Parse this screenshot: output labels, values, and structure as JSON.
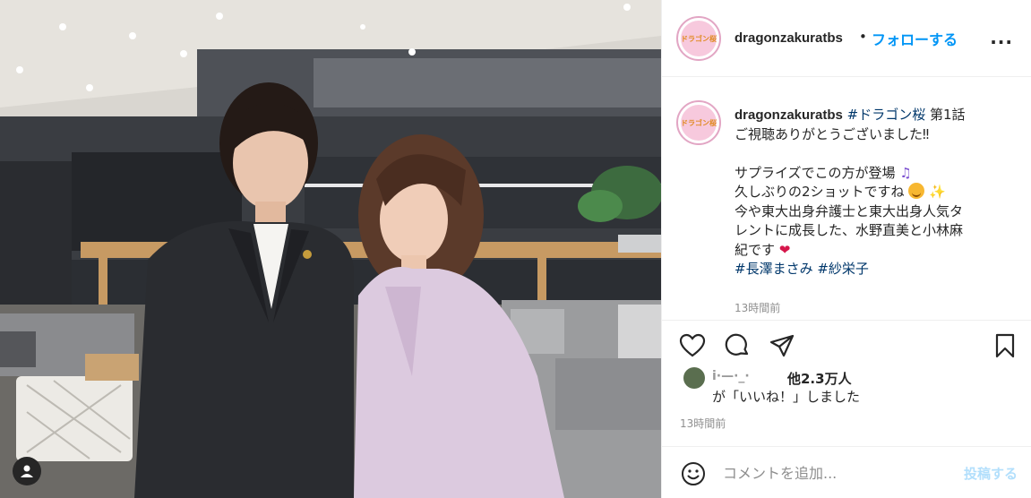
{
  "post": {
    "author": "dragonzakuratbs",
    "follow_separator": "•",
    "follow_label": "フォローする",
    "more_label": "...",
    "avatar_text": "ドラゴン桜",
    "caption": {
      "hashtag_title": "#ドラゴン桜",
      "episode": "第1話",
      "line2": "ご視聴ありがとうございました‼",
      "line3": "サプライズでこの方が登場",
      "line4": "久しぶりの2ショットですね",
      "line5": "今や東大出身弁護士と東大出身人気タ",
      "line6": "レントに成長した、水野直美と小林麻",
      "line7": "紀です",
      "tag1": "#長澤まさみ",
      "tag2": "#紗栄子",
      "time": "13時間前"
    },
    "likes": {
      "liker_name": "i·—·_·",
      "count": "他2.3万人",
      "suffix": "が「いいね！」しました"
    },
    "timestamp": "13時間前",
    "comment": {
      "placeholder": "コメントを追加...",
      "post_label": "投稿する"
    }
  },
  "icons": {
    "like": "heart-icon",
    "comment": "comment-icon",
    "share": "paper-plane-icon",
    "save": "bookmark-icon",
    "emoji": "smiley-icon",
    "more": "more-horizontal-icon",
    "user_tag": "person-icon"
  },
  "colors": {
    "follow": "#0095f6",
    "link": "#00376b",
    "muted": "#8e8e8e",
    "post_disabled": "#b2dffc"
  }
}
